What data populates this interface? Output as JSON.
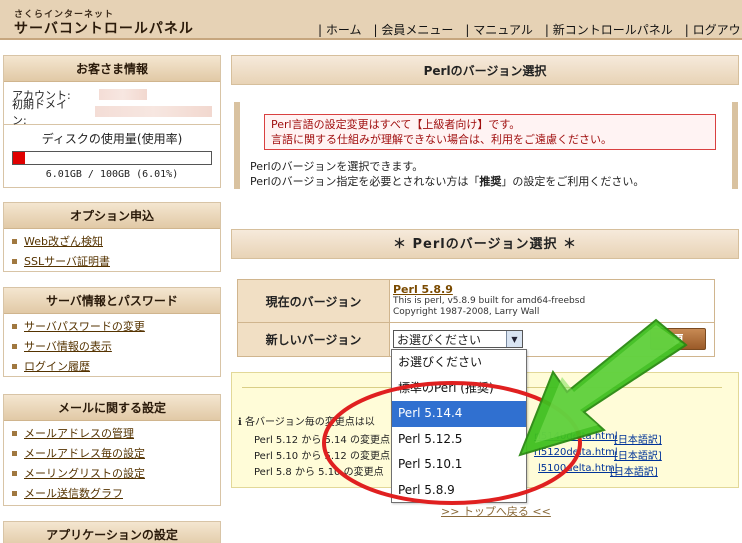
{
  "header": {
    "logo_sub": "さくらインターネット",
    "logo_main": "サーバコントロールパネル",
    "nav": [
      "ホーム",
      "会員メニュー",
      "マニュアル",
      "新コントロールパネル",
      "ログアウト"
    ]
  },
  "sidebar": {
    "customer": {
      "title": "お客さま情報",
      "account_label": "アカウント:",
      "domain_label": "初期ドメイン:",
      "disk_label": "ディスクの使用量(使用率)",
      "disk_value": "6.01GB / 100GB (6.01%)",
      "disk_ratio": 0.0601
    },
    "options": {
      "title": "オプション申込",
      "links": [
        "Web改ざん検知",
        "SSLサーバ証明書"
      ]
    },
    "server": {
      "title": "サーバ情報とパスワード",
      "links": [
        "サーバパスワードの変更",
        "サーバ情報の表示",
        "ログイン履歴"
      ]
    },
    "mail": {
      "title": "メールに関する設定",
      "links": [
        "メールアドレスの管理",
        "メールアドレス毎の設定",
        "メーリングリストの設定",
        "メール送信数グラフ"
      ]
    },
    "apps": {
      "title": "アプリケーションの設定"
    }
  },
  "main": {
    "title": "Perlのバージョン選択",
    "warning_line1": "Perl言語の設定変更はすべて【上級者向け】です。",
    "warning_line2": "言語に関する仕組みが理解できない場合は、利用をご遠慮ください。",
    "notice_line1": "Perlのバージョンを選択できます。",
    "notice_line2_pre": "Perlのバージョン指定を必要とされない方は「",
    "notice_line2_bold": "推奨",
    "notice_line2_post": "」の設定をご利用ください。",
    "section_title": "＊ Perlのバージョン選択 ＊",
    "current_label": "現在のバージョン",
    "current_name": "Perl 5.8.9",
    "current_line1": "This is perl, v5.8.9 built for amd64-freebsd",
    "current_line2": "Copyright 1987-2008, Larry Wall",
    "new_label": "新しいバージョン",
    "select_value": "お選びください",
    "change_button": "更",
    "lower": {
      "line0": "各バージョン毎の変更点は以",
      "line1": "Perl 5.12 から 5.14 の変更点",
      "line2": "Perl 5.10 から 5.12 の変更点",
      "line3": "Perl 5.8 から 5.10 の変更点",
      "link1": "rl5140delta.html",
      "link2": "rl5120delta.html",
      "link3": "l5100delta.html",
      "jp1": "[日本語訳]",
      "jp2": "[日本語訳]",
      "jp3": "[日本語訳]"
    },
    "back_link": ">> トップへ戻る <<",
    "dropdown": [
      "お選びください",
      "標準のPerl (推奨)",
      "Perl 5.14.4",
      "Perl 5.12.5",
      "Perl 5.10.1",
      "Perl 5.8.9"
    ],
    "dropdown_selected": 2
  },
  "colors": {
    "arrow_green": "#3fbf1f",
    "circle_red": "#e02020",
    "highlight_blue": "#3070d0"
  }
}
